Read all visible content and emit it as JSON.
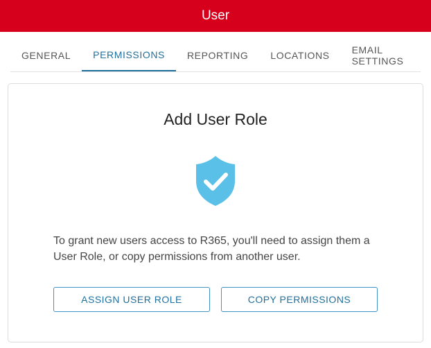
{
  "colors": {
    "header_bg": "#d7001c",
    "accent": "#1f6f9e",
    "button_border": "#3f92c4",
    "shield": "#5bc0e8"
  },
  "header": {
    "title": "User"
  },
  "tabs": [
    {
      "label": "GENERAL",
      "active": false
    },
    {
      "label": "PERMISSIONS",
      "active": true
    },
    {
      "label": "REPORTING",
      "active": false
    },
    {
      "label": "LOCATIONS",
      "active": false
    },
    {
      "label": "EMAIL SETTINGS",
      "active": false
    }
  ],
  "card": {
    "title": "Add User Role",
    "icon": "shield-check-icon",
    "description": "To grant new users access to R365, you'll need to assign them a User Role, or copy permissions from another user.",
    "assign_button": "ASSIGN USER ROLE",
    "copy_button": "COPY PERMISSIONS"
  }
}
